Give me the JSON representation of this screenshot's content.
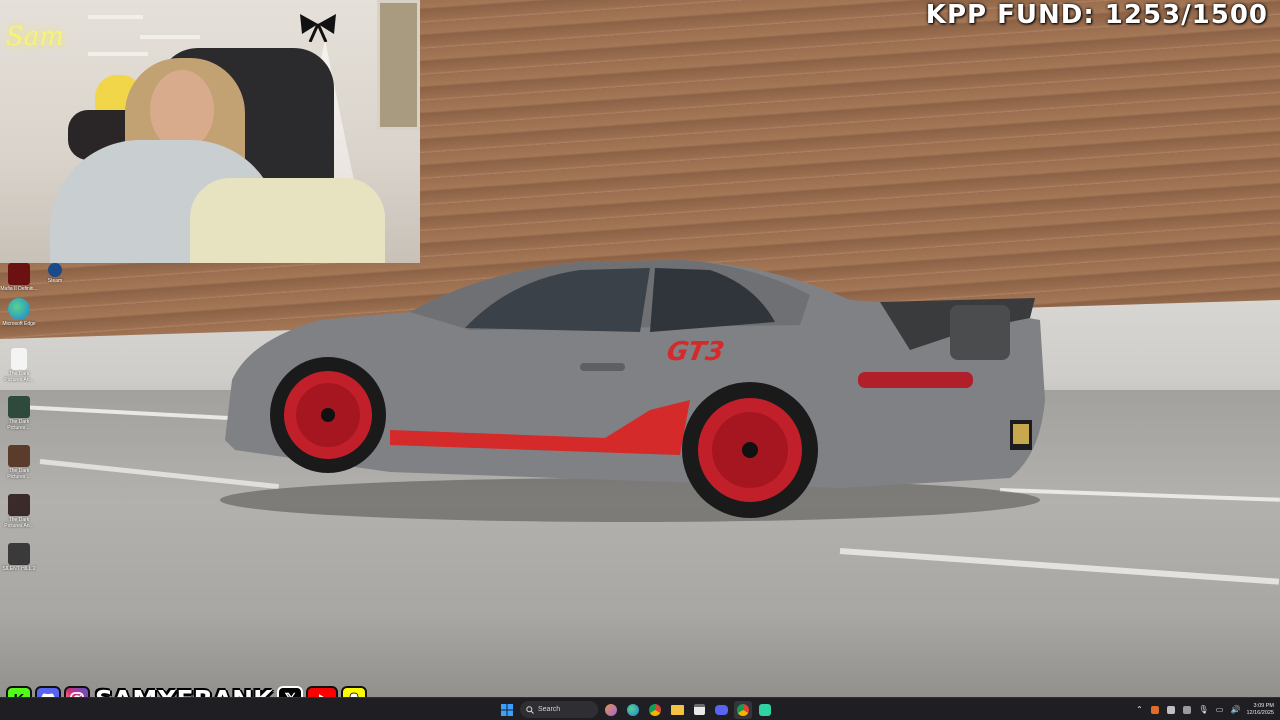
{
  "overlay": {
    "fund_text": "KPP FUND: 1253/1500"
  },
  "webcam": {
    "neon_sign": "Sam"
  },
  "social_bar": {
    "handle": "SAMXFRANK",
    "icons": [
      "kick-icon",
      "discord-icon",
      "instagram-icon",
      "x-icon",
      "youtube-icon",
      "snapchat-icon"
    ],
    "colors": {
      "kick": "#53fc18",
      "discord": "#5865f2",
      "instagram": "#d62976",
      "x": "#000000",
      "youtube": "#ff0000",
      "snapchat": "#fffc00"
    }
  },
  "desktop_icons": [
    {
      "label": "Mafia II Definiti...",
      "icon": "mafia-icon"
    },
    {
      "label": "Steam",
      "icon": "steam-icon"
    },
    {
      "label": "Microsoft Edge",
      "icon": "edge-icon"
    },
    {
      "label": "The Dark Pictures An...",
      "icon": "file-icon"
    },
    {
      "label": "The Dark Pictures ...",
      "icon": "dark-pictures-icon"
    },
    {
      "label": "The Dark Pictures ...",
      "icon": "dark-pictures-icon"
    },
    {
      "label": "The Dark Pictures An...",
      "icon": "dark-pictures-icon"
    },
    {
      "label": "SILENT HILL 2",
      "icon": "silent-hill-icon"
    }
  ],
  "taskbar": {
    "search_label": "Search",
    "pinned_apps": [
      "file-explorer-icon",
      "edge-icon",
      "chrome-icon",
      "folder-icon",
      "calendar-icon",
      "discord-icon",
      "chrome-icon",
      "app-icon"
    ],
    "clock_time": "3:09 PM",
    "clock_date": "12/16/2025"
  },
  "colors": {
    "taskbar_bg": "#1f1f23",
    "car_body": "#7f8184",
    "car_accent": "#d42a2a"
  }
}
